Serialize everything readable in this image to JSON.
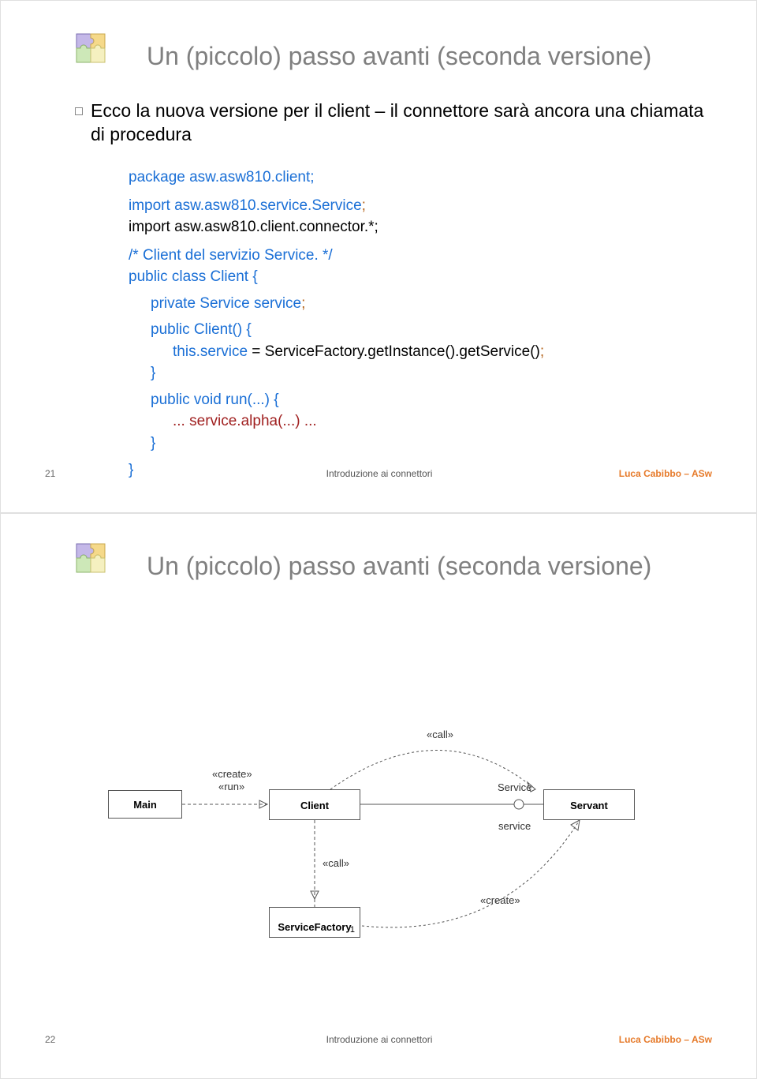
{
  "slide1": {
    "title": "Un (piccolo) passo avanti (seconda versione)",
    "bullet": "Ecco la nuova versione per il client – il connettore sarà ancora una chiamata di procedura",
    "code": {
      "l1": "package asw.asw810.client;",
      "l2a": "import asw.asw810.service.Service",
      "l2b": ";",
      "l3": "import asw.asw810.client.connector.*;",
      "l4": "/* Client del servizio Service. */",
      "l5": "public class Client {",
      "l6a": "private Service service",
      "l6b": ";",
      "l7": "public Client() {",
      "l8a": "this.service",
      "l8b": " = ServiceFactory.getInstance().getService()",
      "l8c": ";",
      "l9": "}",
      "l10": "public void run(...) {",
      "l11a": "...",
      "l11b": " service.alpha(...) ",
      "l11c": "...",
      "l12": "}",
      "l13": "}"
    },
    "page": "21",
    "footer_mid": "Introduzione ai connettori",
    "footer_right": "Luca Cabibbo – ASw"
  },
  "slide2": {
    "title": "Un (piccolo) passo avanti (seconda versione)",
    "boxes": {
      "main": "Main",
      "client": "Client",
      "servant": "Servant",
      "sf": "ServiceFactory",
      "sf_mult": "1"
    },
    "labels": {
      "create_run1": "«create»",
      "create_run2": "«run»",
      "call_top": "«call»",
      "service_iface": "Service",
      "service_role": "service",
      "call_down": "«call»",
      "create_sf": "«create»"
    },
    "page": "22",
    "footer_mid": "Introduzione ai connettori",
    "footer_right": "Luca Cabibbo – ASw"
  }
}
